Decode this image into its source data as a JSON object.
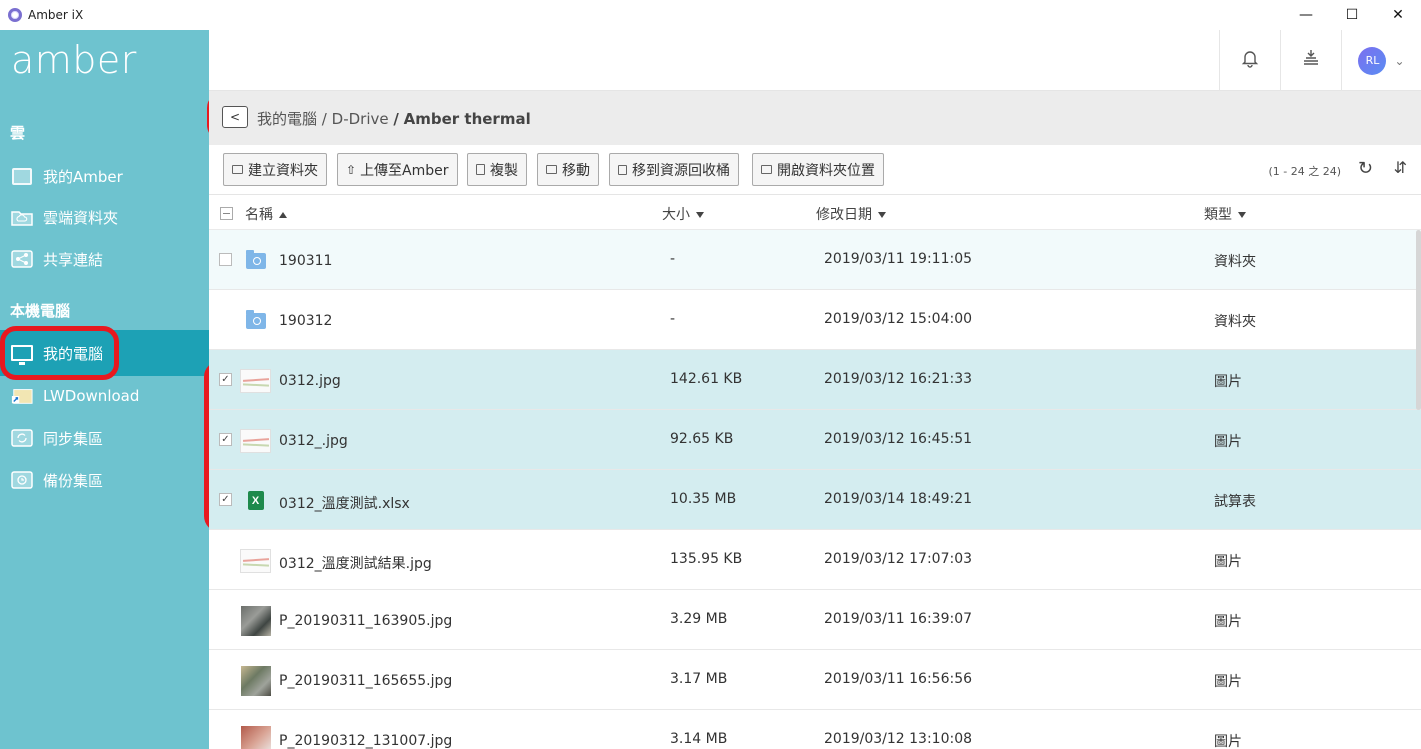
{
  "window": {
    "title": "Amber iX",
    "minimize": "—",
    "maximize": "☐",
    "close": "✕"
  },
  "sidebar": {
    "logo": "amber",
    "section_cloud": "雲",
    "cloud_items": [
      {
        "label": "我的Amber",
        "icon": "amber-box-icon"
      },
      {
        "label": "雲端資料夾",
        "icon": "cloud-folder-icon"
      },
      {
        "label": "共享連結",
        "icon": "share-link-icon"
      }
    ],
    "section_local": "本機電腦",
    "local_items": [
      {
        "label": "我的電腦",
        "icon": "monitor-icon",
        "active": true
      },
      {
        "label": "LWDownload",
        "icon": "shortcut-folder-icon"
      },
      {
        "label": "同步集區",
        "icon": "sync-icon"
      },
      {
        "label": "備份集區",
        "icon": "backup-icon"
      }
    ]
  },
  "header": {
    "notifications_icon": "bell-icon",
    "queue_icon": "stack-icon",
    "avatar_initials": "RL",
    "menu_chevron": "chevron-down-icon"
  },
  "breadcrumb": {
    "back": "<",
    "path1": "我的電腦",
    "sep1": "/",
    "path2": "D-Drive",
    "sep2": "/",
    "current": "Amber thermal"
  },
  "toolbar": {
    "new_folder": "建立資料夾",
    "upload": "上傳至Amber",
    "copy": "複製",
    "move": "移動",
    "recycle": "移到資源回收桶",
    "open_location": "開啟資料夾位置",
    "page_info": "(1 - 24 之 24)",
    "refresh_icon": "↻",
    "sort_icon": "⇵"
  },
  "table": {
    "headers": {
      "name": "名稱",
      "size": "大小",
      "modified": "修改日期",
      "type": "類型"
    },
    "rows": [
      {
        "name": "190311",
        "size": "-",
        "date": "2019/03/11 19:11:05",
        "type": "資料夾",
        "icon": "folder",
        "checked": false,
        "selected": false,
        "show_cb": true
      },
      {
        "name": "190312",
        "size": "-",
        "date": "2019/03/12 15:04:00",
        "type": "資料夾",
        "icon": "folder",
        "checked": false,
        "selected": false,
        "show_cb": false
      },
      {
        "name": "0312.jpg",
        "size": "142.61 KB",
        "date": "2019/03/12 16:21:33",
        "type": "圖片",
        "icon": "image",
        "checked": true,
        "selected": true,
        "show_cb": true
      },
      {
        "name": "0312_.jpg",
        "size": "92.65 KB",
        "date": "2019/03/12 16:45:51",
        "type": "圖片",
        "icon": "image",
        "checked": true,
        "selected": true,
        "show_cb": true
      },
      {
        "name": "0312_溫度測試.xlsx",
        "size": "10.35 MB",
        "date": "2019/03/14 18:49:21",
        "type": "試算表",
        "icon": "xlsx",
        "checked": true,
        "selected": true,
        "show_cb": true
      },
      {
        "name": "0312_溫度測試結果.jpg",
        "size": "135.95 KB",
        "date": "2019/03/12 17:07:03",
        "type": "圖片",
        "icon": "image",
        "checked": false,
        "selected": false,
        "show_cb": false
      },
      {
        "name": "P_20190311_163905.jpg",
        "size": "3.29 MB",
        "date": "2019/03/11 16:39:07",
        "type": "圖片",
        "icon": "photo1",
        "checked": false,
        "selected": false,
        "show_cb": false
      },
      {
        "name": "P_20190311_165655.jpg",
        "size": "3.17 MB",
        "date": "2019/03/11 16:56:56",
        "type": "圖片",
        "icon": "photo2",
        "checked": false,
        "selected": false,
        "show_cb": false
      },
      {
        "name": "P_20190312_131007.jpg",
        "size": "3.14 MB",
        "date": "2019/03/12 13:10:08",
        "type": "圖片",
        "icon": "photo3",
        "checked": false,
        "selected": false,
        "show_cb": false
      }
    ]
  },
  "colors": {
    "sidebar": "#6ec3cf",
    "sidebar_active": "#1da1b5",
    "selected_row": "#d4edf0",
    "highlight_ring": "#e8191f"
  }
}
